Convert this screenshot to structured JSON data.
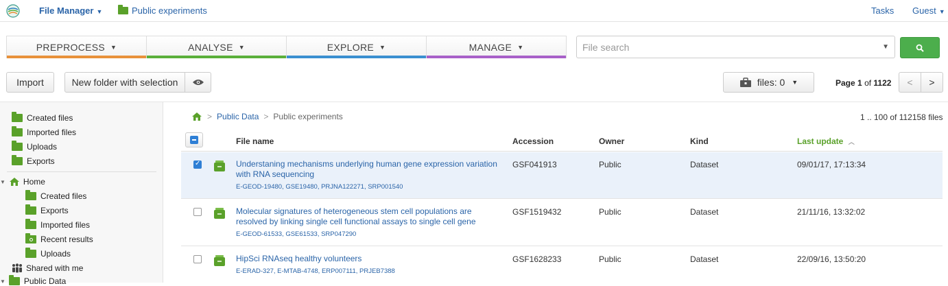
{
  "topbar": {
    "app_title": "File Manager",
    "location": "Public experiments",
    "tasks": "Tasks",
    "user": "Guest"
  },
  "nav": [
    {
      "label": "PREPROCESS",
      "color": "#e8913a"
    },
    {
      "label": "ANALYSE",
      "color": "#5aaf3a"
    },
    {
      "label": "EXPLORE",
      "color": "#3a8fd0"
    },
    {
      "label": "MANAGE",
      "color": "#a860c8"
    }
  ],
  "search": {
    "placeholder": "File search"
  },
  "toolbar": {
    "import": "Import",
    "new_folder": "New folder with selection",
    "files": "files: 0",
    "page_label": "Page",
    "page_num": "1",
    "page_of": "of",
    "page_total": "1122",
    "prev": "<",
    "next": ">"
  },
  "sidebar": {
    "top": [
      "Created files",
      "Imported files",
      "Uploads",
      "Exports"
    ],
    "home": "Home",
    "home_items": [
      "Created files",
      "Exports",
      "Imported files",
      "Recent results",
      "Uploads"
    ],
    "shared": "Shared with me",
    "public": "Public Data"
  },
  "breadcrumb": {
    "sep": ">",
    "parent": "Public Data",
    "current": "Public experiments"
  },
  "count": "1 .. 100 of 112158 files",
  "table": {
    "headers": {
      "name": "File name",
      "accession": "Accession",
      "owner": "Owner",
      "kind": "Kind",
      "updated": "Last update"
    },
    "rows": [
      {
        "selected": true,
        "name_l1": "Understaning mechanisms underlying human gene expression variation",
        "name_l2": "with RNA sequencing",
        "tags": "E-GEOD-19480, GSE19480, PRJNA122271, SRP001540",
        "accession": "GSF041913",
        "owner": "Public",
        "kind": "Dataset",
        "updated": "09/01/17, 17:13:34"
      },
      {
        "selected": false,
        "name_l1": "Molecular signatures of heterogeneous stem cell populations are",
        "name_l2": "resolved by linking single cell functional assays to single cell gene",
        "tags": "E-GEOD-61533, GSE61533, SRP047290",
        "accession": "GSF1519432",
        "owner": "Public",
        "kind": "Dataset",
        "updated": "21/11/16, 13:32:02"
      },
      {
        "selected": false,
        "name_l1": "HipSci RNAseq healthy volunteers",
        "name_l2": "",
        "tags": "E-ERAD-327, E-MTAB-4748, ERP007111, PRJEB7388",
        "accession": "GSF1628233",
        "owner": "Public",
        "kind": "Dataset",
        "updated": "22/09/16, 13:50:20"
      }
    ]
  }
}
